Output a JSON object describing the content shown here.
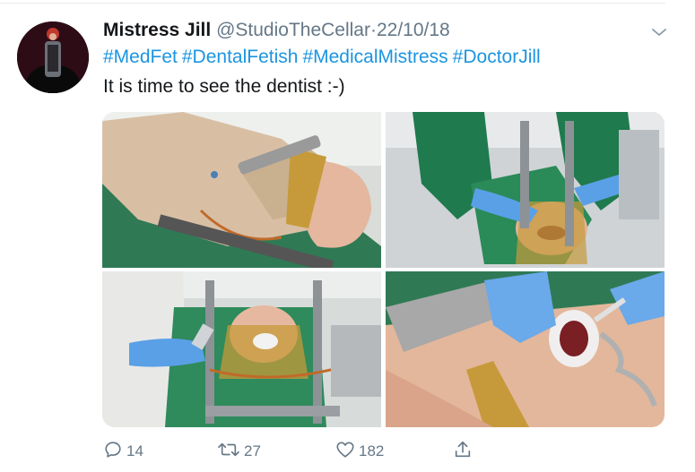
{
  "tweet": {
    "author_name": "Mistress Jill",
    "handle": "@StudioTheCellar",
    "separator": "·",
    "date": "22/10/18",
    "hashtags": [
      "#MedFet",
      "#DentalFetish",
      "#MedicalMistress",
      "#DoctorJill"
    ],
    "text": "It is time to see the dentist :-)"
  },
  "actions": {
    "replies": "14",
    "retweets": "27",
    "likes": "182"
  },
  "icons": {
    "caret": "chevron-down-icon",
    "reply": "reply-icon",
    "retweet": "retweet-icon",
    "like": "heart-icon",
    "share": "share-icon"
  },
  "colors": {
    "link": "#1b95e0",
    "secondary_text": "#657786"
  }
}
